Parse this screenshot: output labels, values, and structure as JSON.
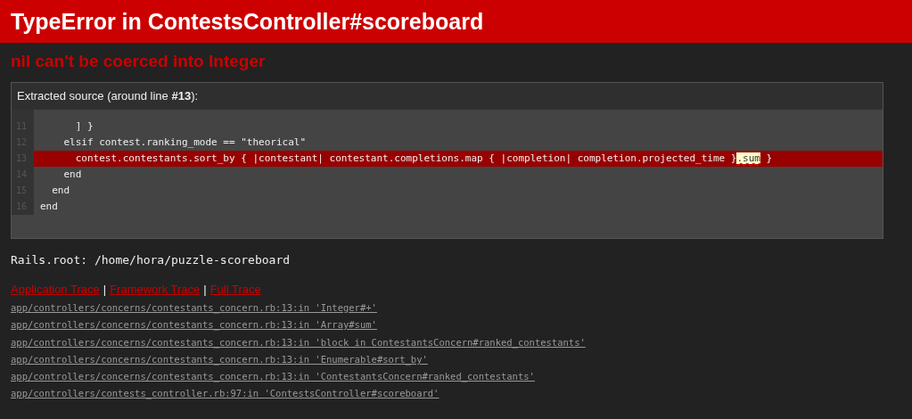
{
  "header": {
    "title": "TypeError in ContestsController#scoreboard"
  },
  "message": "nil can't be coerced into Integer",
  "source": {
    "caption": "Extracted source (around line **#13**):",
    "lines": [
      {
        "number": "11",
        "selected": false,
        "parts": [
          {
            "kind": "plain",
            "text": "      ] }"
          }
        ]
      },
      {
        "number": "12",
        "selected": false,
        "parts": [
          {
            "kind": "plain",
            "text": "    elsif contest.ranking_mode == \"theorical\""
          }
        ]
      },
      {
        "number": "13",
        "selected": true,
        "parts": [
          {
            "kind": "plain",
            "text": "      contest.contestants.sort_by { |contestant| contestant.completions.map { |completion| completion.projected_time }"
          },
          {
            "kind": "error",
            "text": ".sum"
          },
          {
            "kind": "plain",
            "text": " }"
          }
        ]
      },
      {
        "number": "14",
        "selected": false,
        "parts": [
          {
            "kind": "plain",
            "text": "    end"
          }
        ]
      },
      {
        "number": "15",
        "selected": false,
        "parts": [
          {
            "kind": "plain",
            "text": "  end"
          }
        ]
      },
      {
        "number": "16",
        "selected": false,
        "parts": [
          {
            "kind": "plain",
            "text": "end"
          }
        ]
      }
    ]
  },
  "rails_root": "Rails.root: /home/hora/puzzle-scoreboard",
  "trace_tabs": [
    {
      "label": "Application Trace"
    },
    {
      "label": "Framework Trace"
    },
    {
      "label": "Full Trace"
    }
  ],
  "trace_separator": "|",
  "trace": [
    "app/controllers/concerns/contestants_concern.rb:13:in 'Integer#+'",
    "app/controllers/concerns/contestants_concern.rb:13:in 'Array#sum'",
    "app/controllers/concerns/contestants_concern.rb:13:in 'block in ContestantsConcern#ranked_contestants'",
    "app/controllers/concerns/contestants_concern.rb:13:in 'Enumerable#sort_by'",
    "app/controllers/concerns/contestants_concern.rb:13:in 'ContestantsConcern#ranked_contestants'",
    "app/controllers/contests_controller.rb:97:in 'ContestsController#scoreboard'"
  ]
}
